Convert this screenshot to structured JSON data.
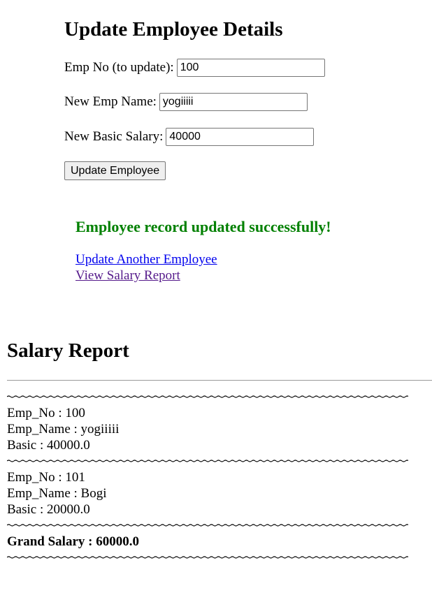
{
  "update_form": {
    "title": "Update Employee Details",
    "empno_label": "Emp No (to update):",
    "empno_value": "100",
    "name_label": "New Emp Name:",
    "name_value": "yogiiiii",
    "salary_label": "New Basic Salary:",
    "salary_value": "40000",
    "submit_label": "Update Employee"
  },
  "result": {
    "message": "Employee record updated successfully!",
    "message_color": "#008000",
    "links": [
      {
        "label": "Update Another Employee",
        "color": "#0000ee"
      },
      {
        "label": "View Salary Report",
        "color": "#551a8b"
      }
    ]
  },
  "report": {
    "title": "Salary Report",
    "employees": [
      {
        "emp_no": "Emp_No : 100",
        "emp_name": "Emp_Name : yogiiiii",
        "basic": "Basic : 40000.0"
      },
      {
        "emp_no": "Emp_No : 101",
        "emp_name": "Emp_Name : Bogi",
        "basic": "Basic : 20000.0"
      }
    ],
    "grand_total": "Grand Salary : 60000.0"
  }
}
